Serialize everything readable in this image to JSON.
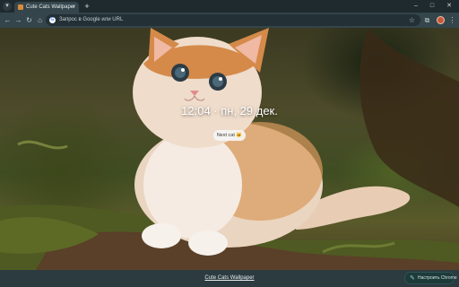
{
  "browser": {
    "tab": {
      "title": "Cute Cats Wallpaper",
      "close_glyph": "×",
      "favicon_icon": "image-icon"
    },
    "new_tab_glyph": "+",
    "search_tabs_glyph": "▾",
    "window_controls": {
      "minimize": "–",
      "maximize": "□",
      "close": "✕"
    },
    "toolbar": {
      "back": "←",
      "forward": "→",
      "reload": "↻",
      "home": "⌂",
      "omnibox": {
        "icon_letter": "G",
        "placeholder": "Запрос в Google или URL"
      },
      "bookmark_star": "☆",
      "extensions": "⧉",
      "download": "⬇",
      "menu": "⋮"
    }
  },
  "page": {
    "clock": "12:04 · пн, 29 дек.",
    "next_button": {
      "label": "Next cat",
      "emoji": "🐱"
    },
    "footer_link": "Cute Cats Wallpaper",
    "customize": {
      "icon": "pencil-icon",
      "glyph": "✎",
      "label": "Настроить Chrome"
    }
  }
}
